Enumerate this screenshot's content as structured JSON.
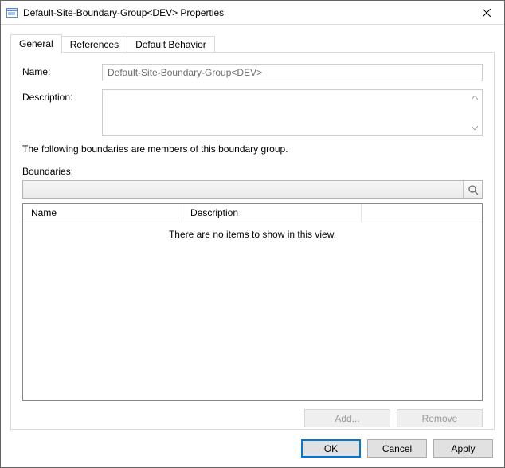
{
  "window": {
    "title": "Default-Site-Boundary-Group<DEV> Properties"
  },
  "tabs": {
    "general": "General",
    "references": "References",
    "default_behavior": "Default Behavior"
  },
  "general": {
    "name_label": "Name:",
    "name_value": "Default-Site-Boundary-Group<DEV>",
    "description_label": "Description:",
    "description_value": "",
    "helper_text": "The following boundaries are members of this boundary group.",
    "boundaries_label": "Boundaries:",
    "filter_placeholder": "",
    "columns": {
      "name": "Name",
      "description": "Description"
    },
    "empty_text": "There are no items to show in this view.",
    "add_label": "Add...",
    "remove_label": "Remove"
  },
  "buttons": {
    "ok": "OK",
    "cancel": "Cancel",
    "apply": "Apply"
  }
}
